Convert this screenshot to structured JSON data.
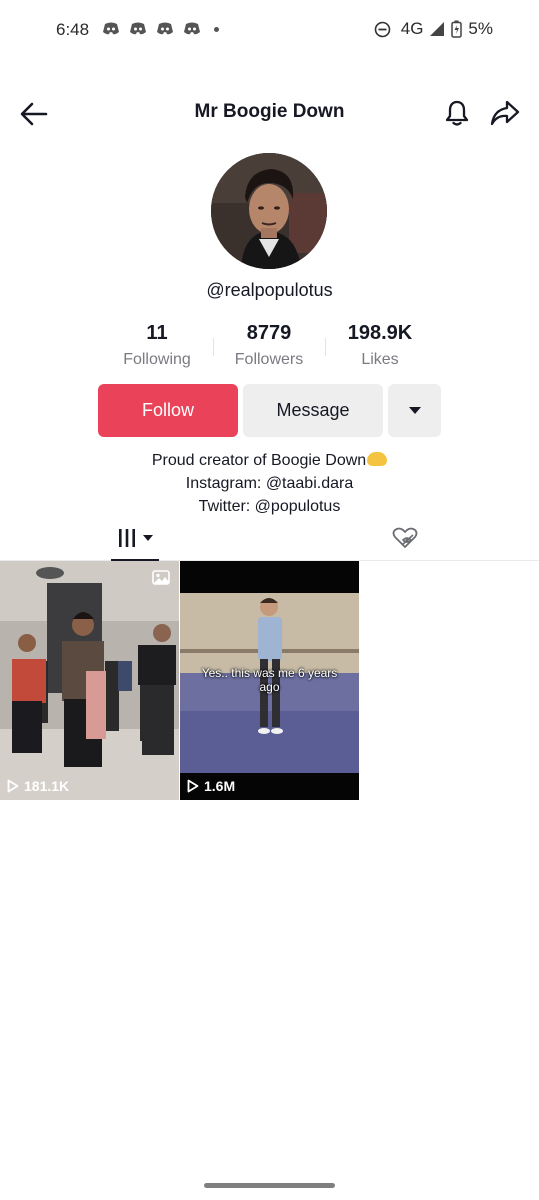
{
  "status_bar": {
    "time": "6:48",
    "network": "4G",
    "battery": "5%",
    "notification_icons": [
      "discord-icon",
      "discord-icon",
      "discord-icon",
      "discord-icon"
    ]
  },
  "header": {
    "title": "Mr Boogie Down"
  },
  "profile": {
    "username": "@realpopulotus",
    "stats": [
      {
        "value": "11",
        "label": "Following"
      },
      {
        "value": "8779",
        "label": "Followers"
      },
      {
        "value": "198.9K",
        "label": "Likes"
      }
    ],
    "buttons": {
      "follow": "Follow",
      "message": "Message"
    },
    "bio": {
      "line1": "Proud creator of Boogie Down",
      "line2": "Instagram: @taabi.dara",
      "line3": "Twitter: @populotus"
    }
  },
  "videos": [
    {
      "views": "181.1K",
      "caption": ""
    },
    {
      "views": "1.6M",
      "caption": "Yes.. this was me 6 years ago"
    }
  ],
  "colors": {
    "accent": "#ea4359",
    "text": "#161823",
    "muted": "#7a7b82",
    "button_bg": "#eeeeef"
  }
}
